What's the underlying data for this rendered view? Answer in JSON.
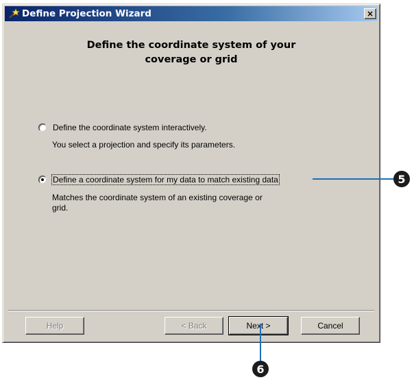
{
  "window": {
    "title": "Define Projection Wizard",
    "close_glyph": "×"
  },
  "main": {
    "heading_line1": "Define the coordinate system of your",
    "heading_line2": "coverage or grid",
    "options": [
      {
        "label": "Define the coordinate system interactively.",
        "description": "You select a projection and specify its parameters.",
        "selected": false
      },
      {
        "label": "Define a coordinate system for my data to match existing data",
        "description_line1": "Matches the coordinate system of an existing coverage or",
        "description_line2": "grid.",
        "selected": true
      }
    ]
  },
  "buttons": {
    "help": "Help",
    "back": "< Back",
    "next": "Next >",
    "cancel": "Cancel"
  },
  "callouts": [
    {
      "number": "5"
    },
    {
      "number": "6"
    }
  ],
  "colors": {
    "title_active_start": "#0a246a",
    "title_active_end": "#a6caf0",
    "dialog_face": "#d4d0c8",
    "callout_line": "#1d6fb8",
    "callout_badge": "#1c1c1c"
  },
  "icons": {
    "title": "wizard-wand-icon",
    "close": "close-icon"
  }
}
